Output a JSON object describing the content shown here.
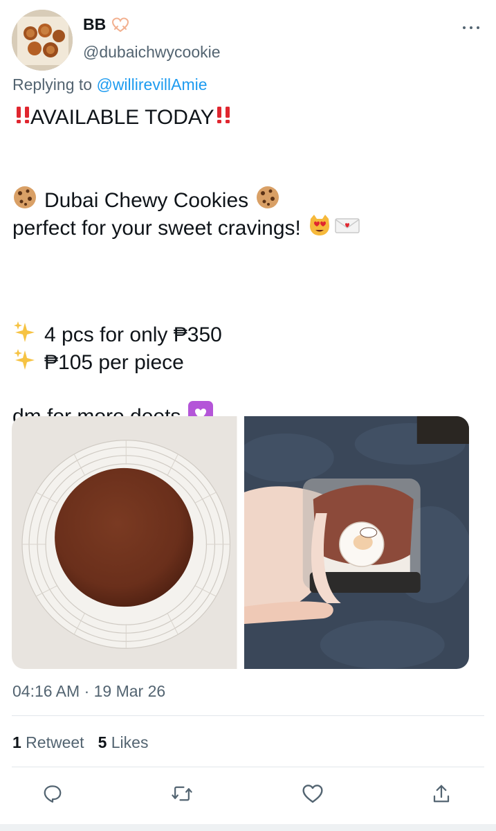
{
  "author": {
    "display_name": "BB",
    "handle": "@dubaichwycookie",
    "avatar_alt": "avatar",
    "badge_icon": "heart-hands-icon"
  },
  "reply": {
    "prefix": "Replying to ",
    "to": "@willirevillAmie"
  },
  "tweet": {
    "line1": "AVAILABLE TODAY",
    "line2": "Dubai Chewy Cookies",
    "line3": "perfect for your sweet cravings!",
    "line4": "4 pcs for only ₱350",
    "line5": "₱105 per piece",
    "line6": "dm for more deets"
  },
  "meta": {
    "timestamp": "04:16 AM · 19 Mar 26",
    "retweet_count": "1",
    "retweet_label": " Retweet",
    "like_count": "5",
    "like_label": " Likes"
  },
  "actions": {
    "reply_icon": "reply-icon",
    "retweet_icon": "retweet-icon",
    "like_icon": "heart-icon",
    "share_icon": "share-icon"
  },
  "colors": {
    "link": "#1d9bf0",
    "secondary_text": "#536471",
    "primary_text": "#0f1419",
    "divider": "#e1e6ea",
    "icon_gray": "#536471"
  }
}
